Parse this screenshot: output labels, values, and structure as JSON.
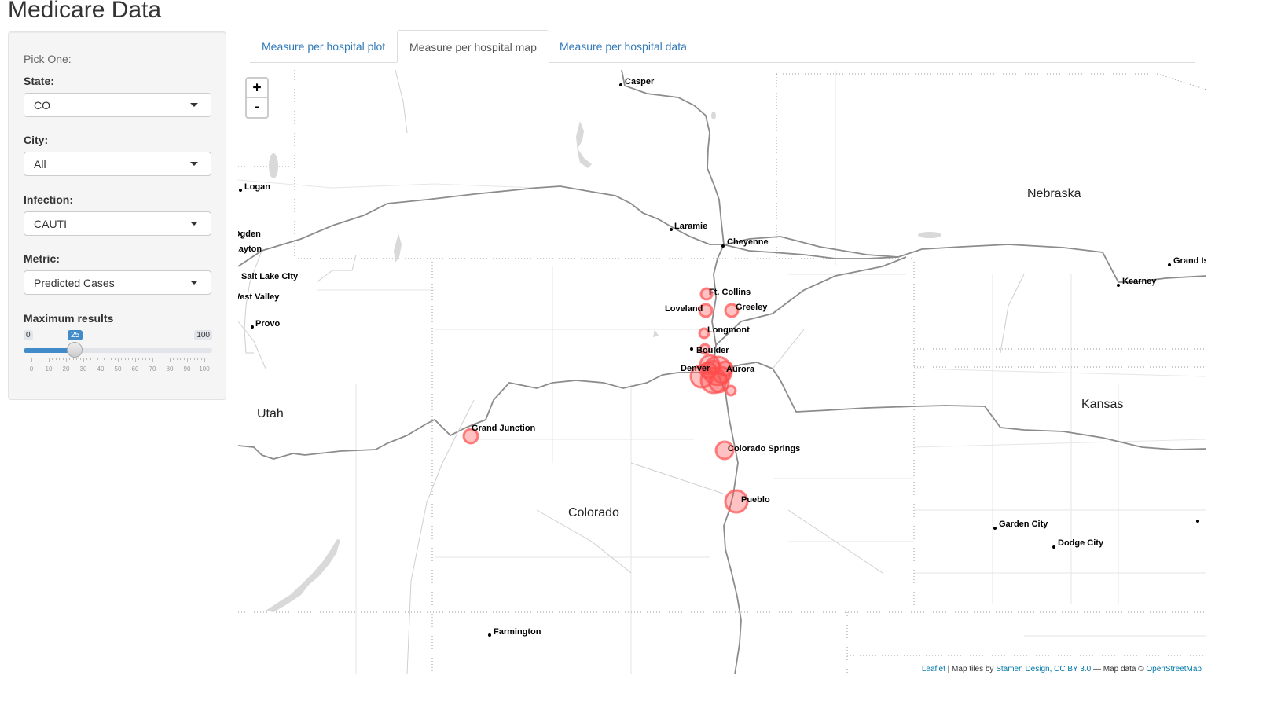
{
  "app": {
    "title": "Medicare Data"
  },
  "sidebar": {
    "pick_label": "Pick One:",
    "state": {
      "label": "State:",
      "value": "CO"
    },
    "city": {
      "label": "City:",
      "value": "All"
    },
    "infection": {
      "label": "Infection:",
      "value": "CAUTI"
    },
    "metric": {
      "label": "Metric:",
      "value": "Predicted Cases"
    },
    "max_results": {
      "label": "Maximum results",
      "min": 0,
      "max": 100,
      "value": 25,
      "min_label": "0",
      "max_label": "100",
      "value_label": "25",
      "ticks": [
        "0",
        "10",
        "20",
        "30",
        "40",
        "50",
        "60",
        "70",
        "80",
        "90",
        "100"
      ]
    }
  },
  "tabs": [
    {
      "label": "Measure per hospital plot",
      "active": false
    },
    {
      "label": "Measure per hospital map",
      "active": true
    },
    {
      "label": "Measure per hospital data",
      "active": false
    }
  ],
  "map": {
    "zoom_in": "+",
    "zoom_out": "-",
    "marker_color": "#ff4d4d",
    "region_labels": [
      "Nebraska",
      "Kansas",
      "Utah",
      "Colorado"
    ],
    "cities": [
      "Casper",
      "Logan",
      "Laramie",
      "Cheyenne",
      "Ogden",
      "Layton",
      "Salt Lake City",
      "West Valley",
      "Provo",
      "Ft. Collins",
      "Loveland",
      "Greeley",
      "Longmont",
      "Boulder",
      "Denver",
      "Aurora",
      "Grand Junction",
      "Colorado Springs",
      "Pueblo",
      "Farmington",
      "Garden City",
      "Dodge City",
      "Kearney",
      "Grand Island"
    ],
    "attribution": {
      "leaflet": "Leaflet",
      "tiles_prefix": " | Map tiles by ",
      "stamen": "Stamen Design, CC BY 3.0",
      "data_prefix": " — Map data © ",
      "osm": "OpenStreetMap"
    }
  }
}
